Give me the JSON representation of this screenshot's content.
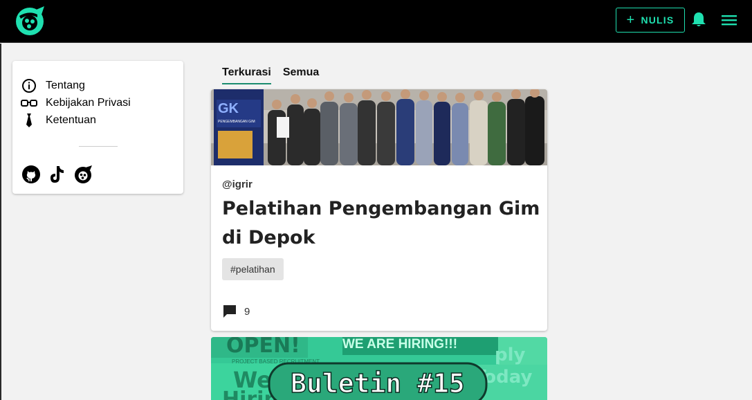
{
  "header": {
    "write_label": "NULIS"
  },
  "sidebar": {
    "items": [
      {
        "label": "Tentang",
        "icon": "info-icon"
      },
      {
        "label": "Kebijakan Privasi",
        "icon": "glasses-icon"
      },
      {
        "label": "Ketentuan",
        "icon": "tie-icon"
      }
    ],
    "social": [
      "github-icon",
      "tiktok-icon",
      "site-logo-icon"
    ]
  },
  "tabs": [
    {
      "label": "Terkurasi",
      "active": true
    },
    {
      "label": "Semua",
      "active": false
    }
  ],
  "posts": [
    {
      "author": "@igrir",
      "title": "Pelatihan Pengembangan Gim di Depok",
      "tag": "#pelatihan",
      "comments": "9",
      "banner_text": "PENGEMBANGAN GIM"
    },
    {
      "banner": {
        "title": "Buletin #15",
        "bg_words": [
          "OPEN!",
          "WE ARE HIRING!!!",
          "We",
          "Hirin",
          "Today",
          "ply",
          "PROJECT BASED RECRUITMENT"
        ]
      }
    }
  ],
  "colors": {
    "accent": "#1fe0b0",
    "tab_underline": "#1a8c6e",
    "topbar": "#000000"
  }
}
